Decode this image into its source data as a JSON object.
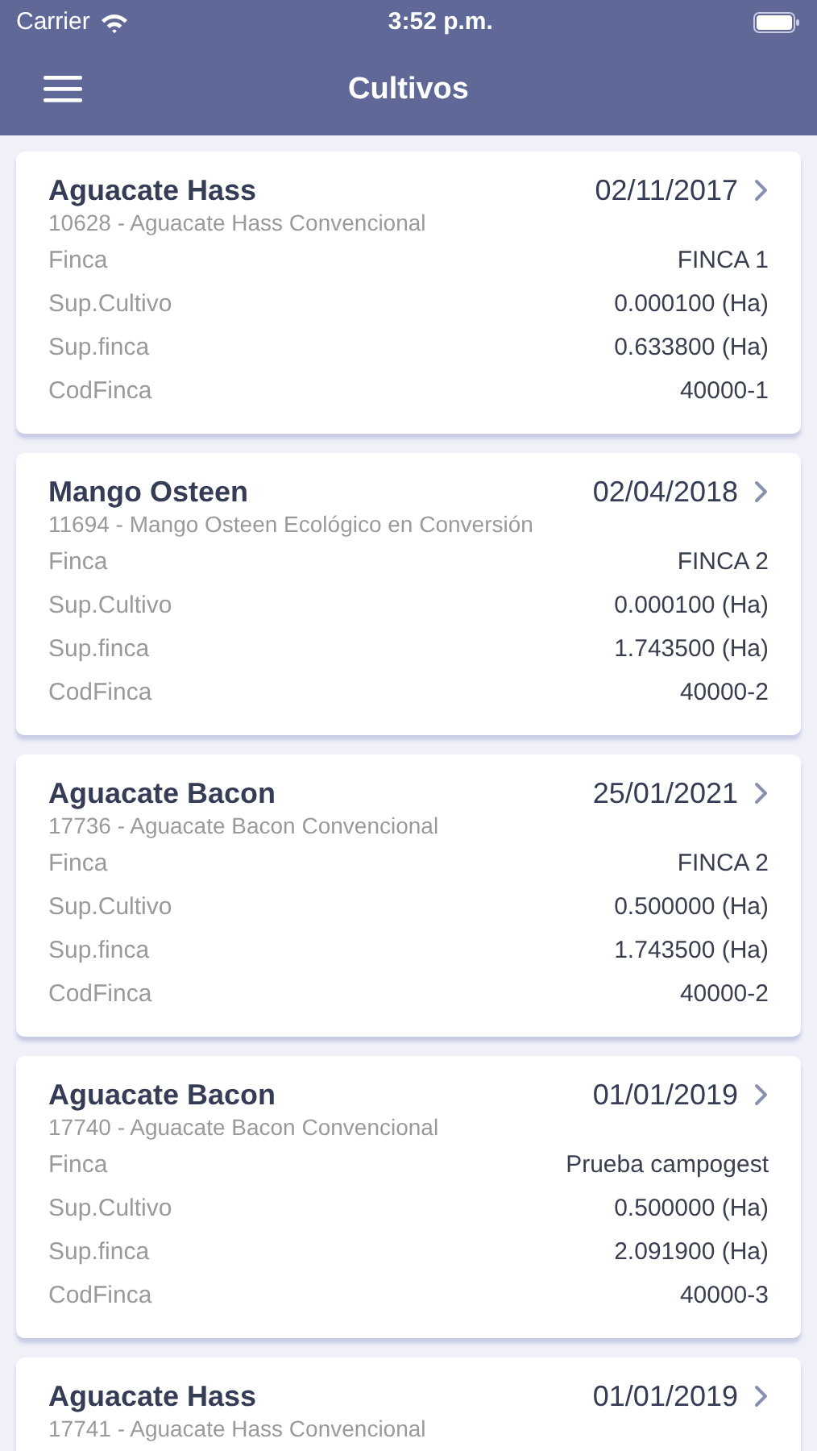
{
  "status_bar": {
    "carrier": "Carrier",
    "time": "3:52 p.m."
  },
  "nav_bar": {
    "title": "Cultivos"
  },
  "cards": [
    {
      "name": "Aguacate Hass",
      "date": "02/11/2017",
      "subtitle": "10628 - Aguacate Hass Convencional",
      "fields": [
        {
          "label": "Finca",
          "value": "FINCA 1"
        },
        {
          "label": "Sup.Cultivo",
          "value": "0.000100 (Ha)"
        },
        {
          "label": "Sup.finca",
          "value": "0.633800 (Ha)"
        },
        {
          "label": "CodFinca",
          "value": "40000-1"
        }
      ]
    },
    {
      "name": "Mango Osteen",
      "date": "02/04/2018",
      "subtitle": "11694 - Mango Osteen Ecológico en Conversión",
      "fields": [
        {
          "label": "Finca",
          "value": "FINCA 2"
        },
        {
          "label": "Sup.Cultivo",
          "value": "0.000100 (Ha)"
        },
        {
          "label": "Sup.finca",
          "value": "1.743500 (Ha)"
        },
        {
          "label": "CodFinca",
          "value": "40000-2"
        }
      ]
    },
    {
      "name": "Aguacate Bacon",
      "date": "25/01/2021",
      "subtitle": "17736 - Aguacate Bacon Convencional",
      "fields": [
        {
          "label": "Finca",
          "value": "FINCA 2"
        },
        {
          "label": "Sup.Cultivo",
          "value": "0.500000 (Ha)"
        },
        {
          "label": "Sup.finca",
          "value": "1.743500 (Ha)"
        },
        {
          "label": "CodFinca",
          "value": "40000-2"
        }
      ]
    },
    {
      "name": "Aguacate Bacon",
      "date": "01/01/2019",
      "subtitle": "17740 - Aguacate Bacon Convencional",
      "fields": [
        {
          "label": "Finca",
          "value": "Prueba campogest"
        },
        {
          "label": "Sup.Cultivo",
          "value": "0.500000 (Ha)"
        },
        {
          "label": "Sup.finca",
          "value": "2.091900 (Ha)"
        },
        {
          "label": "CodFinca",
          "value": "40000-3"
        }
      ]
    },
    {
      "name": "Aguacate Hass",
      "date": "01/01/2019",
      "subtitle": "17741 - Aguacate Hass Convencional"
    }
  ]
}
